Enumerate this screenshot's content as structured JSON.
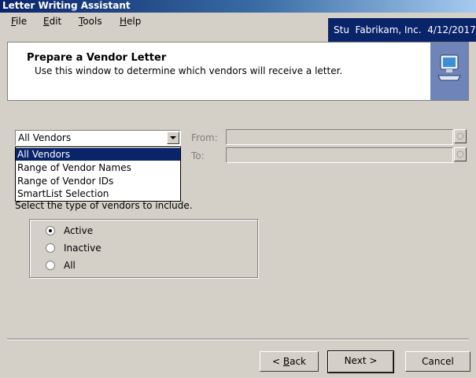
{
  "window": {
    "title": "Letter Writing Assistant"
  },
  "menu": [
    {
      "label": "File",
      "mnemonic": "F",
      "rest": "ile"
    },
    {
      "label": "Edit",
      "mnemonic": "E",
      "rest": "dit"
    },
    {
      "label": "Tools",
      "mnemonic": "T",
      "rest": "ools"
    },
    {
      "label": "Help",
      "mnemonic": "H",
      "rest": "elp"
    }
  ],
  "company_info": "Stu  Fabrikam, Inc.  4/12/2017",
  "header": {
    "title": "Prepare a Vendor Letter",
    "description": "Use this window to determine which vendors will receive a letter.",
    "icon": "computer-wizard-icon"
  },
  "vendor_range": {
    "selected": "All Vendors",
    "options": [
      "All Vendors",
      "Range of Vendor Names",
      "Range of Vendor IDs",
      "SmartList Selection"
    ],
    "from_label": "From:",
    "to_label": "To:",
    "from_value": "",
    "to_value": ""
  },
  "vendor_type": {
    "label": "Select the type of vendors to include.",
    "options": [
      {
        "label": "Active",
        "checked": true
      },
      {
        "label": "Inactive",
        "checked": false
      },
      {
        "label": "All",
        "checked": false
      }
    ]
  },
  "buttons": {
    "back": "< Back",
    "back_mnemonic_prefix": "< ",
    "back_mnemonic": "B",
    "back_rest": "ack",
    "next": "Next >",
    "cancel": "Cancel"
  },
  "colors": {
    "title_bar": "#0a246a",
    "selection": "#0a246a",
    "face": "#d4d0c8"
  }
}
